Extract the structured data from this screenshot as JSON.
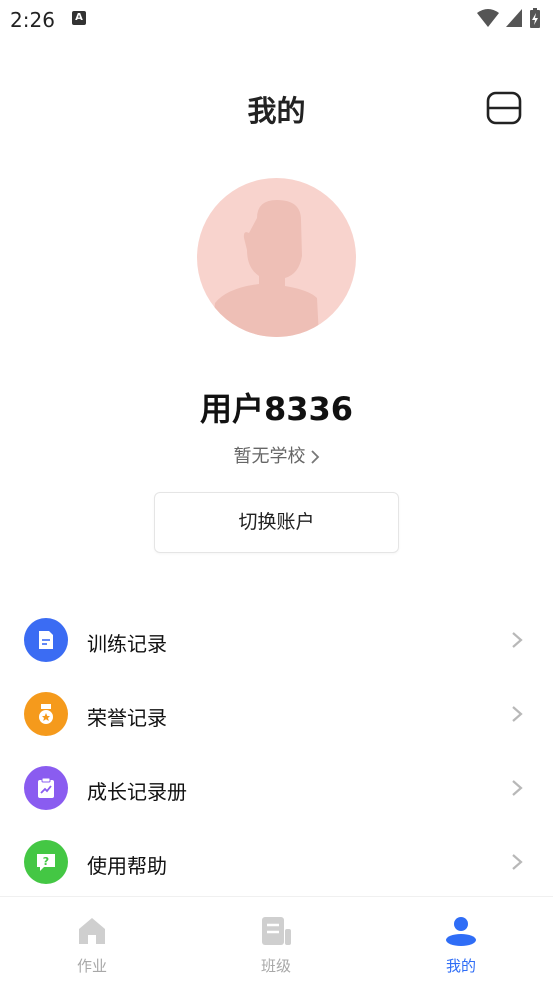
{
  "status_bar": {
    "time": "2:26",
    "notification_badge": "A"
  },
  "header": {
    "title": "我的"
  },
  "profile": {
    "username": "用户8336",
    "school": "暂无学校",
    "switch_account_label": "切换账户"
  },
  "menu": {
    "items": [
      {
        "label": "训练记录",
        "icon": "document-icon",
        "color": "#3b6cf3"
      },
      {
        "label": "荣誉记录",
        "icon": "medal-icon",
        "color": "#f59a1c"
      },
      {
        "label": "成长记录册",
        "icon": "clipboard-chart-icon",
        "color": "#8a5cf0"
      },
      {
        "label": "使用帮助",
        "icon": "help-chat-icon",
        "color": "#44c744"
      }
    ]
  },
  "bottom_nav": {
    "items": [
      {
        "label": "作业",
        "icon": "home-icon",
        "active": false
      },
      {
        "label": "班级",
        "icon": "class-icon",
        "active": false
      },
      {
        "label": "我的",
        "icon": "user-icon",
        "active": true
      }
    ]
  },
  "colors": {
    "accent": "#2f6df6",
    "avatar_bg": "#f8d3cd",
    "inactive_nav": "#a8a8a8"
  }
}
